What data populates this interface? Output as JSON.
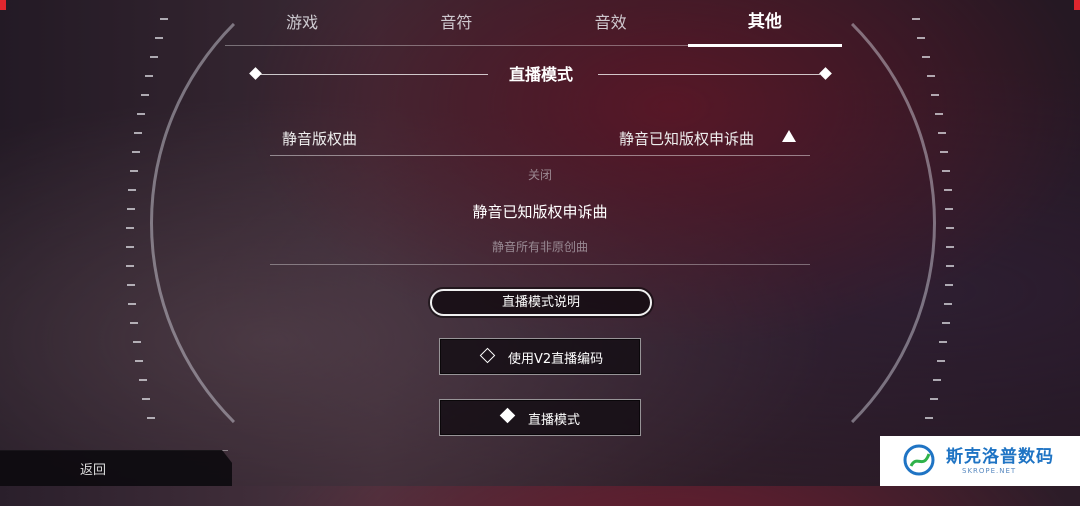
{
  "tabs": [
    {
      "label": "游戏",
      "active": false
    },
    {
      "label": "音符",
      "active": false
    },
    {
      "label": "音效",
      "active": false
    },
    {
      "label": "其他",
      "active": true
    }
  ],
  "section": {
    "title": "直播模式"
  },
  "dropdown": {
    "label": "静音版权曲",
    "value": "静音已知版权申诉曲",
    "options": [
      "关闭",
      "静音已知版权申诉曲",
      "静音所有非原创曲"
    ],
    "selected_option": "静音已知版权申诉曲"
  },
  "buttons": {
    "explain_label": "直播模式说明",
    "v2_encoding_label": "使用V2直播编码",
    "v2_encoding_checked": false,
    "live_mode_label": "直播模式",
    "live_mode_checked": true
  },
  "footer": {
    "back_label": "返回"
  },
  "watermark": {
    "title": "斯克洛普数码",
    "subtitle": "SKROPE.NET"
  },
  "colors": {
    "accent": "#ffffff",
    "watermark_blue": "#1f74c4",
    "corner_red": "#e0262e"
  }
}
